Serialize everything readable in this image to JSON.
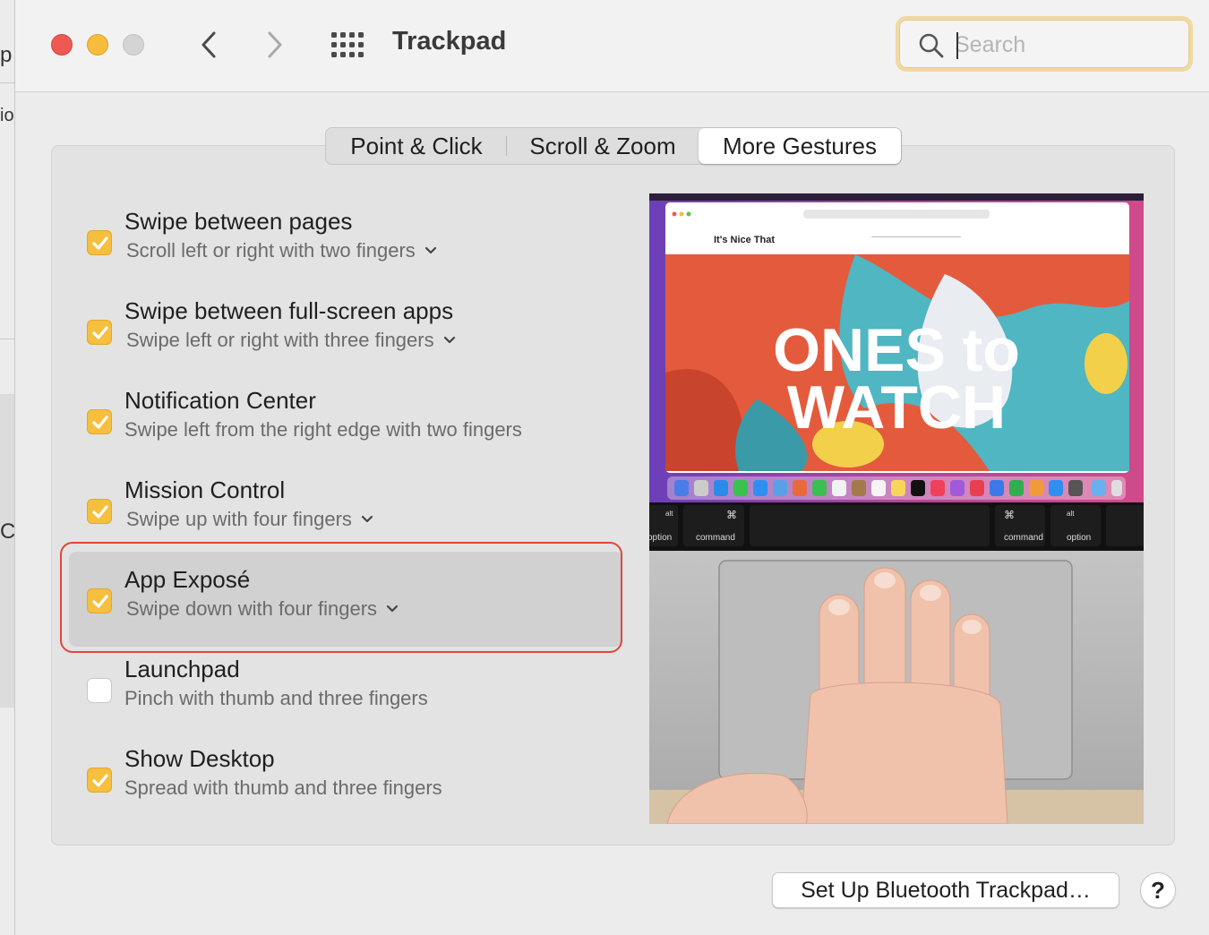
{
  "background_app": {
    "fragments": [
      "p",
      "io",
      "C"
    ]
  },
  "window": {
    "title": "Trackpad"
  },
  "search": {
    "placeholder": "Search",
    "value": ""
  },
  "tabs": [
    {
      "label": "Point & Click",
      "selected": false
    },
    {
      "label": "Scroll & Zoom",
      "selected": false
    },
    {
      "label": "More Gestures",
      "selected": true
    }
  ],
  "gestures": [
    {
      "name": "Swipe between pages",
      "detail": "Scroll left or right with two fingers",
      "checked": true,
      "has_menu": true
    },
    {
      "name": "Swipe between full-screen apps",
      "detail": "Swipe left or right with three fingers",
      "checked": true,
      "has_menu": true
    },
    {
      "name": "Notification Center",
      "detail": "Swipe left from the right edge with two fingers",
      "checked": true,
      "has_menu": false
    },
    {
      "name": "Mission Control",
      "detail": "Swipe up with four fingers",
      "checked": true,
      "has_menu": true
    },
    {
      "name": "App Exposé",
      "detail": "Swipe down with four fingers",
      "checked": true,
      "has_menu": true,
      "highlighted": true
    },
    {
      "name": "Launchpad",
      "detail": "Pinch with thumb and three fingers",
      "checked": false,
      "has_menu": false
    },
    {
      "name": "Show Desktop",
      "detail": "Spread with thumb and three fingers",
      "checked": true,
      "has_menu": false
    }
  ],
  "preview": {
    "site_logo": "It's Nice That",
    "headline_line1": "ONES to",
    "headline_line2": "WATCH",
    "keys": [
      "option",
      "command",
      "command",
      "option"
    ],
    "key_alt": "alt",
    "key_cmd_symbol": "⌘"
  },
  "footer": {
    "bluetooth_button": "Set Up Bluetooth Trackpad…",
    "help_button": "?"
  },
  "colors": {
    "checkbox_accent": "#f6bf3e",
    "highlight_ring": "#e0463a",
    "traffic_red": "#ee5a52",
    "traffic_yellow": "#f5bd3b"
  }
}
